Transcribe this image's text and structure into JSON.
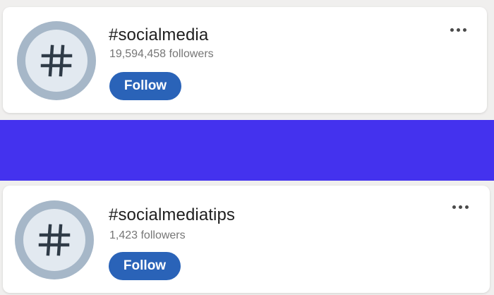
{
  "hashtags": [
    {
      "name": "#socialmedia",
      "followers": "19,594,458 followers",
      "follow_label": "Follow"
    },
    {
      "name": "#socialmediatips",
      "followers": "1,423 followers",
      "follow_label": "Follow"
    }
  ],
  "icons": {
    "avatar": "hashtag-icon",
    "more": "more-options-icon"
  },
  "colors": {
    "follow_button": "#2a63b8",
    "divider_band": "#4432ee",
    "avatar_ring": "#a6b7c8",
    "avatar_fill": "#e2e9f0"
  }
}
